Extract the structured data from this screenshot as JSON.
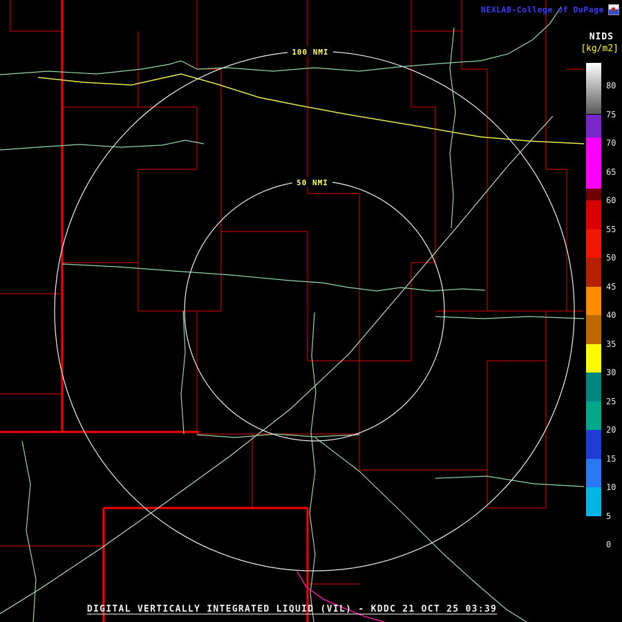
{
  "header": {
    "title": "NEXLAB-College of DuPage"
  },
  "colorbar": {
    "title": "NIDS",
    "units": "[kg/m2]",
    "ticks": [
      80,
      75,
      70,
      65,
      60,
      55,
      50,
      45,
      40,
      35,
      30,
      25,
      20,
      15,
      10,
      5,
      0
    ],
    "segments": [
      {
        "from": 75,
        "to": 84,
        "color": "linear-gradient(to bottom,#ffffff,#5a5a5a)"
      },
      {
        "from": 71,
        "to": 75,
        "color": "#7828c8"
      },
      {
        "from": 62,
        "to": 71,
        "color": "#fc00fc"
      },
      {
        "from": 60,
        "to": 62,
        "color": "#700000"
      },
      {
        "from": 55,
        "to": 60,
        "color": "#d80000"
      },
      {
        "from": 50,
        "to": 55,
        "color": "#f01800"
      },
      {
        "from": 45,
        "to": 50,
        "color": "#b42000"
      },
      {
        "from": 40,
        "to": 45,
        "color": "#ff8c00"
      },
      {
        "from": 35,
        "to": 40,
        "color": "#c06800"
      },
      {
        "from": 30,
        "to": 35,
        "color": "#fcfc00"
      },
      {
        "from": 25,
        "to": 30,
        "color": "#00867c"
      },
      {
        "from": 20,
        "to": 25,
        "color": "#00a88a"
      },
      {
        "from": 15,
        "to": 20,
        "color": "#1e3cd2"
      },
      {
        "from": 10,
        "to": 15,
        "color": "#2878f0"
      },
      {
        "from": 5,
        "to": 10,
        "color": "#00b4e6"
      },
      {
        "from": 0,
        "to": 5,
        "color": "#000000"
      }
    ]
  },
  "map": {
    "station": "KDDC",
    "ring_labels": [
      {
        "text": "100 NMI"
      },
      {
        "text": "50 NMI"
      }
    ],
    "rings_nmi": [
      50,
      100
    ]
  },
  "footer": {
    "caption": "DIGITAL VERTICALLY INTEGRATED LIQUID (VIL) - KDDC 21 OCT 25 03:39",
    "product": "DIGITAL VERTICALLY INTEGRATED LIQUID (VIL)",
    "station": "KDDC",
    "datetime": "21 OCT 25 03:39"
  },
  "colors": {
    "background": "#000000",
    "county_line": "#e60000",
    "county_line_thick": "#ff0000",
    "road": "#96d8a8",
    "road_light": "#b4e4c4",
    "highway_yellow": "#e8e850",
    "road_magenta": "#e8189c",
    "range_ring": "#f2f2f2",
    "ring_label": "#ffff66",
    "header_text": "#3c3cff",
    "footer_text": "#f0f0f0",
    "tick_text": "#e8e8e8",
    "units_text": "#ffff00"
  }
}
